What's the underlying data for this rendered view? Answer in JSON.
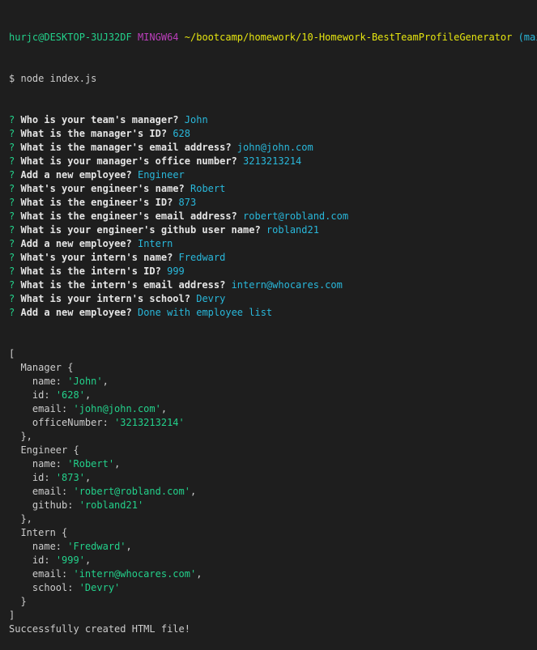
{
  "prompt": {
    "user_host": "hurjc@DESKTOP-3UJ32DF",
    "shell": "MINGW64",
    "path": "~/bootcamp/homework/10-Homework-BestTeamProfileGenerator",
    "branch": "(main)",
    "symbol": "$",
    "command": "node index.js"
  },
  "questions": [
    {
      "mark": "?",
      "q": "Who is your team's manager?",
      "a": "John"
    },
    {
      "mark": "?",
      "q": "What is the manager's ID?",
      "a": "628"
    },
    {
      "mark": "?",
      "q": "What is the manager's email address?",
      "a": "john@john.com"
    },
    {
      "mark": "?",
      "q": "What is your manager's office number?",
      "a": "3213213214"
    },
    {
      "mark": "?",
      "q": "Add a new employee?",
      "a": "Engineer"
    },
    {
      "mark": "?",
      "q": "What's your engineer's name?",
      "a": "Robert"
    },
    {
      "mark": "?",
      "q": "What is the engineer's ID?",
      "a": "873"
    },
    {
      "mark": "?",
      "q": "What is the engineer's email address?",
      "a": "robert@robland.com"
    },
    {
      "mark": "?",
      "q": "What is your engineer's github user name?",
      "a": "robland21"
    },
    {
      "mark": "?",
      "q": "Add a new employee?",
      "a": "Intern"
    },
    {
      "mark": "?",
      "q": "What's your intern's name?",
      "a": "Fredward"
    },
    {
      "mark": "?",
      "q": "What is the intern's ID?",
      "a": "999"
    },
    {
      "mark": "?",
      "q": "What is the intern's email address?",
      "a": "intern@whocares.com"
    },
    {
      "mark": "?",
      "q": "What is your intern's school?",
      "a": "Devry"
    },
    {
      "mark": "?",
      "q": "Add a new employee?",
      "a": "Done with employee list"
    }
  ],
  "output": {
    "open_bracket": "[",
    "close_bracket": "]",
    "objects": [
      {
        "class_open": "Manager {",
        "props": [
          {
            "key": "name: ",
            "value": "'John'",
            "tail": ","
          },
          {
            "key": "id: ",
            "value": "'628'",
            "tail": ","
          },
          {
            "key": "email: ",
            "value": "'john@john.com'",
            "tail": ","
          },
          {
            "key": "officeNumber: ",
            "value": "'3213213214'",
            "tail": ""
          }
        ],
        "class_close": "},"
      },
      {
        "class_open": "Engineer {",
        "props": [
          {
            "key": "name: ",
            "value": "'Robert'",
            "tail": ","
          },
          {
            "key": "id: ",
            "value": "'873'",
            "tail": ","
          },
          {
            "key": "email: ",
            "value": "'robert@robland.com'",
            "tail": ","
          },
          {
            "key": "github: ",
            "value": "'robland21'",
            "tail": ""
          }
        ],
        "class_close": "},"
      },
      {
        "class_open": "Intern {",
        "props": [
          {
            "key": "name: ",
            "value": "'Fredward'",
            "tail": ","
          },
          {
            "key": "id: ",
            "value": "'999'",
            "tail": ","
          },
          {
            "key": "email: ",
            "value": "'intern@whocares.com'",
            "tail": ","
          },
          {
            "key": "school: ",
            "value": "'Devry'",
            "tail": ""
          }
        ],
        "class_close": "}"
      }
    ],
    "success": "Successfully created HTML file!"
  }
}
